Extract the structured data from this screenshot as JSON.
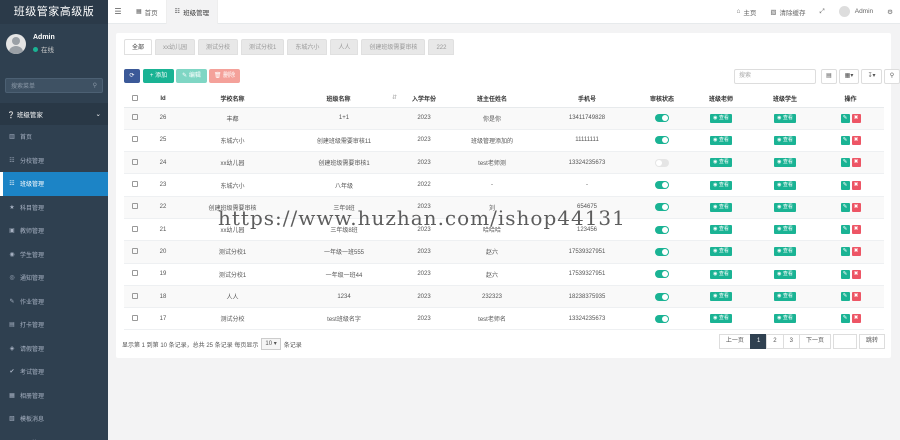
{
  "sidebar": {
    "brand": "班级管家高级版",
    "user": {
      "name": "Admin",
      "status": "在线"
    },
    "search_placeholder": "搜索菜单",
    "group_label": "班级管家",
    "items": [
      {
        "icon": "▥",
        "label": "首页"
      },
      {
        "icon": "☷",
        "label": "分校管理"
      },
      {
        "icon": "☷",
        "label": "班级管理"
      },
      {
        "icon": "★",
        "label": "科目管理"
      },
      {
        "icon": "▣",
        "label": "教师管理"
      },
      {
        "icon": "◉",
        "label": "学生管理"
      },
      {
        "icon": "◎",
        "label": "通知管理"
      },
      {
        "icon": "✎",
        "label": "作业管理"
      },
      {
        "icon": "▤",
        "label": "打卡管理"
      },
      {
        "icon": "◈",
        "label": "请假管理"
      },
      {
        "icon": "✔",
        "label": "考试管理"
      },
      {
        "icon": "▦",
        "label": "相册管理"
      },
      {
        "icon": "▧",
        "label": "模板消息"
      },
      {
        "icon": "▭",
        "label": "页面管理"
      }
    ],
    "active_index": 2
  },
  "topbar": {
    "tabs": [
      {
        "label": "首页"
      },
      {
        "label": "班级管理"
      }
    ],
    "right": {
      "home": "主页",
      "clear_cache": "清除缓存",
      "admin": "Admin"
    }
  },
  "subtabs": [
    "全部",
    "xx幼儿园",
    "测试分校",
    "测试分校1",
    "东城六小",
    "人人",
    "创建班级需要审核",
    "222"
  ],
  "toolbar": {
    "add": "添加",
    "edit": "编辑",
    "delete": "删除",
    "search_placeholder": "搜索"
  },
  "table": {
    "headers": [
      "Id",
      "学校名称",
      "班级名称",
      "入学年份",
      "班主任姓名",
      "手机号",
      "审核状态",
      "班级老师",
      "班级学生",
      "操作"
    ],
    "view_label": "查看",
    "rows": [
      {
        "id": "26",
        "school": "丰都",
        "cls": "1+1",
        "year": "2023",
        "teacher": "你是你",
        "phone": "13411749828",
        "status": true
      },
      {
        "id": "25",
        "school": "东城六小",
        "cls": "创建班级需要审核11",
        "year": "2023",
        "teacher": "班级管理添加的",
        "phone": "11111111",
        "status": true
      },
      {
        "id": "24",
        "school": "xx幼儿园",
        "cls": "创建班级需要审核1",
        "year": "2023",
        "teacher": "test老师测",
        "phone": "13324235673",
        "status": false
      },
      {
        "id": "23",
        "school": "东城六小",
        "cls": "八年级",
        "year": "2022",
        "teacher": "-",
        "phone": "-",
        "status": true
      },
      {
        "id": "22",
        "school": "创建班级需要审核",
        "cls": "三年9班",
        "year": "2023",
        "teacher": "刘",
        "phone": "654675",
        "status": true
      },
      {
        "id": "21",
        "school": "xx幼儿园",
        "cls": "三年级8班",
        "year": "2023",
        "teacher": "哈哈哈",
        "phone": "123456",
        "status": true
      },
      {
        "id": "20",
        "school": "测试分校1",
        "cls": "一年级一班555",
        "year": "2023",
        "teacher": "赵六",
        "phone": "17539327951",
        "status": true
      },
      {
        "id": "19",
        "school": "测试分校1",
        "cls": "一年级一班44",
        "year": "2023",
        "teacher": "赵六",
        "phone": "17539327951",
        "status": true
      },
      {
        "id": "18",
        "school": "人人",
        "cls": "1234",
        "year": "2023",
        "teacher": "232323",
        "phone": "18238375935",
        "status": true
      },
      {
        "id": "17",
        "school": "测试分校",
        "cls": "test班级名字",
        "year": "2023",
        "teacher": "test老师名",
        "phone": "13324235673",
        "status": true
      }
    ]
  },
  "footer": {
    "info_before": "显示第 1 到第 10 条记录，总共 25 条记录 每页显示",
    "page_size": "10",
    "info_after": "条记录",
    "prev": "上一页",
    "pages": [
      "1",
      "2",
      "3"
    ],
    "next": "下一页",
    "go": "跳转"
  },
  "watermark": "https://www.huzhan.com/ishop44131",
  "colors": {
    "sidebar": "#2f4050",
    "active": "#1c84c6",
    "primary": "#1ab394",
    "danger": "#ed5565"
  }
}
